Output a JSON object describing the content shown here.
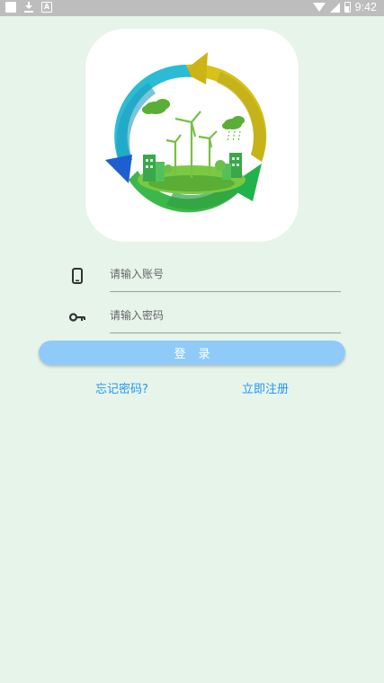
{
  "status_bar": {
    "time": "9:42",
    "left_icons": [
      "square-icon",
      "download-icon",
      "a-icon"
    ],
    "right_icons": [
      "wifi-icon",
      "signal-icon",
      "battery-icon"
    ]
  },
  "logo": {
    "icon": "eco-recycle-city-logo",
    "colors": {
      "green": "#3cb84a",
      "teal": "#2bbcd4",
      "yellow": "#d8c21a",
      "blue": "#1e5fd0"
    }
  },
  "form": {
    "account": {
      "icon": "phone-icon",
      "placeholder": "请输入账号",
      "value": ""
    },
    "password": {
      "icon": "key-icon",
      "placeholder": "请输入密码",
      "value": ""
    }
  },
  "login_button": {
    "label": "登录",
    "color": "#90caf9"
  },
  "links": {
    "forgot": "忘记密码?",
    "register": "立即注册",
    "color": "#2196f3"
  },
  "background_color": "#e6f4ea"
}
